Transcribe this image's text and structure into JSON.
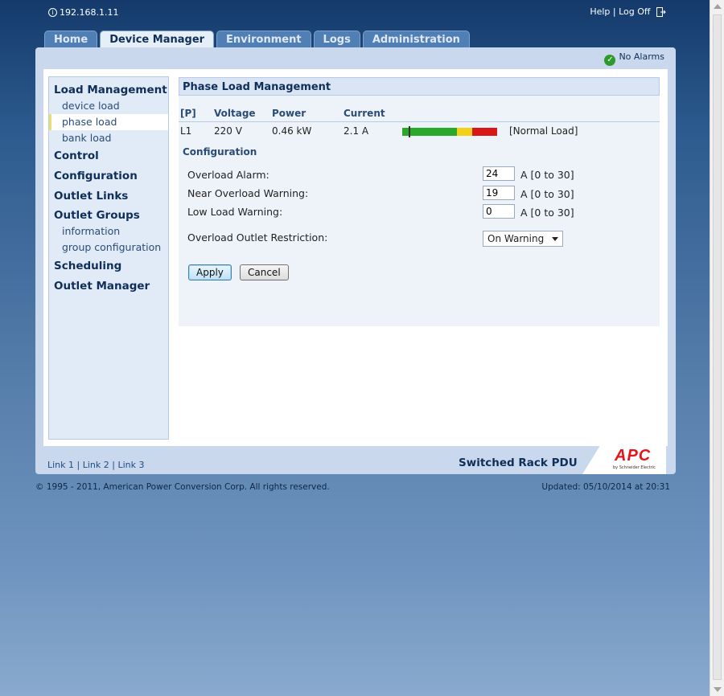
{
  "topbar": {
    "ip": "192.168.1.11",
    "help": "Help",
    "separator": "|",
    "logoff": "Log Off"
  },
  "tabs": [
    {
      "label": "Home",
      "active": false
    },
    {
      "label": "Device Manager",
      "active": true
    },
    {
      "label": "Environment",
      "active": false
    },
    {
      "label": "Logs",
      "active": false
    },
    {
      "label": "Administration",
      "active": false
    }
  ],
  "status": {
    "alarms": "No Alarms"
  },
  "sidebar": {
    "load_management": "Load Management",
    "device_load": "device load",
    "phase_load": "phase load",
    "bank_load": "bank load",
    "control": "Control",
    "configuration": "Configuration",
    "outlet_links": "Outlet Links",
    "outlet_groups": "Outlet Groups",
    "information": "information",
    "group_configuration": "group configuration",
    "scheduling": "Scheduling",
    "outlet_manager": "Outlet Manager"
  },
  "main": {
    "title": "Phase Load Management",
    "columns": {
      "phase": "[P]",
      "voltage": "Voltage",
      "power": "Power",
      "current": "Current"
    },
    "row": {
      "phase": "L1",
      "voltage": "220 V",
      "power": "0.46 kW",
      "current": "2.1 A",
      "status": "[Normal Load]",
      "load_fraction": 0.07
    },
    "config_title": "Configuration",
    "overload_alarm_label": "Overload Alarm:",
    "overload_alarm_value": "24",
    "near_overload_label": "Near Overload Warning:",
    "near_overload_value": "19",
    "low_load_label": "Low Load Warning:",
    "low_load_value": "0",
    "range_text": "A [0 to 30]",
    "restriction_label": "Overload Outlet Restriction:",
    "restriction_value": "On Warning",
    "apply": "Apply",
    "cancel": "Cancel"
  },
  "footer": {
    "link1": "Link 1",
    "link2": "Link 2",
    "link3": "Link 3",
    "sep": "|",
    "product": "Switched Rack PDU",
    "logo": "APC",
    "logo_sub": "by Schneider Electric",
    "copyright": "© 1995 - 2011, American Power Conversion Corp. All rights reserved.",
    "updated": "Updated: 05/10/2014 at 20:31"
  },
  "colors": {
    "accent": "#0f2f58",
    "load_green": "#2aa82a",
    "load_yellow": "#f2d11b",
    "load_red": "#d81717"
  }
}
